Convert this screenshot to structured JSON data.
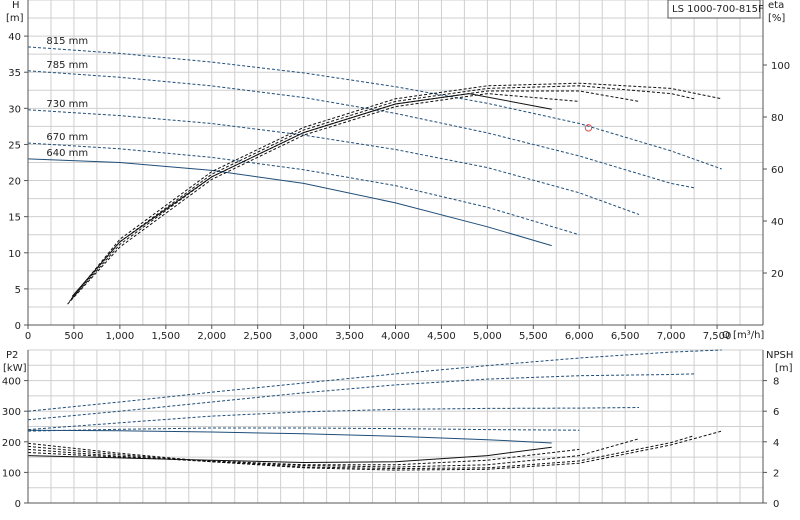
{
  "title_box": "LS 1000-700-815F",
  "top_axes": {
    "y_label_top": "H",
    "y_label_unit": "[m]",
    "y_right_label_top": "eta",
    "y_right_label_unit": "[%]",
    "x_label": "Q [m³/h]",
    "x_ticks": [
      "0",
      "500",
      "1,000",
      "1,500",
      "2,000",
      "2,500",
      "3,000",
      "3,500",
      "4,000",
      "4,500",
      "5,000",
      "5,500",
      "6,000",
      "6,500",
      "7,000",
      "7,500"
    ],
    "y_ticks": [
      "0",
      "5",
      "10",
      "15",
      "20",
      "25",
      "30",
      "35",
      "40"
    ],
    "y_right_ticks": [
      "20",
      "40",
      "60",
      "80",
      "100"
    ]
  },
  "bottom_axes": {
    "y_label_top": "P2",
    "y_label_unit": "[kW]",
    "y_right_label_top": "NPSH",
    "y_right_label_unit": "[m]",
    "y_ticks": [
      "0",
      "100",
      "200",
      "300",
      "400"
    ],
    "y_right_ticks": [
      "0",
      "2",
      "4",
      "6",
      "8"
    ]
  },
  "colors": {
    "blue": "#1f4e79",
    "black": "#111111",
    "marker": "#e05050"
  },
  "chart_data": [
    {
      "type": "line",
      "xlim": [
        0,
        8000
      ],
      "ylim": [
        0,
        45
      ],
      "y2lim": [
        0,
        125
      ],
      "series": [
        {
          "name": "815 mm",
          "style": "dashed",
          "x": [
            0,
            1000,
            2000,
            3000,
            4000,
            5000,
            6000,
            7000,
            7550
          ],
          "y": [
            38.5,
            37.6,
            36.4,
            34.9,
            33.0,
            30.7,
            27.9,
            24.1,
            21.6
          ]
        },
        {
          "name": "785 mm",
          "style": "dashed",
          "x": [
            0,
            1000,
            2000,
            3000,
            4000,
            5000,
            6000,
            7000,
            7250
          ],
          "y": [
            35.2,
            34.3,
            33.1,
            31.5,
            29.3,
            26.6,
            23.4,
            19.6,
            19.0
          ]
        },
        {
          "name": "730 mm",
          "style": "dashed",
          "x": [
            0,
            1000,
            2000,
            3000,
            4000,
            5000,
            6000,
            6650
          ],
          "y": [
            29.8,
            29.0,
            27.9,
            26.3,
            24.3,
            21.8,
            18.3,
            15.3
          ]
        },
        {
          "name": "670 mm",
          "style": "dashed",
          "x": [
            0,
            1000,
            2000,
            3000,
            4000,
            5000,
            6000
          ],
          "y": [
            25.2,
            24.4,
            23.2,
            21.5,
            19.3,
            16.3,
            12.5
          ]
        },
        {
          "name": "640 mm",
          "style": "solid",
          "x": [
            0,
            1000,
            2000,
            3000,
            4000,
            5000,
            5700
          ],
          "y": [
            23.0,
            22.5,
            21.4,
            19.6,
            16.9,
            13.6,
            11.0
          ]
        }
      ],
      "eta_series": [
        {
          "style": "solid",
          "x": [
            480,
            1000,
            2000,
            3000,
            4000,
            4800,
            5700
          ],
          "y": [
            11,
            32,
            57,
            74,
            85,
            89,
            83
          ]
        },
        {
          "style": "dashed",
          "x": [
            430,
            1000,
            2000,
            3000,
            4000,
            5000,
            6000
          ],
          "y": [
            8,
            30,
            56,
            73,
            84,
            89,
            86
          ]
        },
        {
          "style": "dashed",
          "x": [
            450,
            1000,
            2000,
            3000,
            4000,
            5000,
            6000,
            6650
          ],
          "y": [
            9,
            31,
            57,
            74,
            85,
            90,
            90,
            86
          ]
        },
        {
          "style": "dashed",
          "x": [
            470,
            1000,
            2000,
            3000,
            4000,
            5000,
            6000,
            7000,
            7250
          ],
          "y": [
            10,
            32,
            58,
            75,
            86,
            91,
            92,
            89,
            87
          ]
        },
        {
          "style": "dashed",
          "x": [
            490,
            1000,
            2000,
            3000,
            4000,
            5000,
            6000,
            7000,
            7550
          ],
          "y": [
            11,
            33,
            59,
            76,
            87,
            92,
            93,
            91,
            87
          ]
        }
      ],
      "duty_point": {
        "x": 6100,
        "y": 27.3
      }
    },
    {
      "type": "line",
      "xlim": [
        0,
        8000
      ],
      "ylim": [
        0,
        500
      ],
      "y2lim": [
        0,
        10
      ],
      "p2_series": [
        {
          "style": "dashed",
          "x": [
            0,
            1000,
            2000,
            3000,
            4000,
            5000,
            6000,
            7000,
            7550
          ],
          "y": [
            300,
            330,
            362,
            392,
            422,
            449,
            474,
            493,
            500
          ]
        },
        {
          "style": "dashed",
          "x": [
            0,
            1000,
            2000,
            3000,
            4000,
            5000,
            6000,
            7000,
            7250
          ],
          "y": [
            272,
            300,
            330,
            360,
            386,
            405,
            416,
            420,
            422
          ]
        },
        {
          "style": "dashed",
          "x": [
            0,
            1000,
            2000,
            3000,
            4000,
            5000,
            6000,
            6650
          ],
          "y": [
            240,
            262,
            284,
            298,
            306,
            309,
            310,
            312
          ]
        },
        {
          "style": "dashed",
          "x": [
            0,
            1000,
            2000,
            3000,
            4000,
            5000,
            6000
          ],
          "y": [
            235,
            241,
            245,
            245,
            243,
            240,
            238
          ]
        },
        {
          "style": "solid",
          "x": [
            0,
            1000,
            2000,
            3000,
            4000,
            5000,
            5700
          ],
          "y": [
            238,
            236,
            232,
            226,
            218,
            207,
            196
          ]
        }
      ],
      "npsh_series": [
        {
          "style": "solid",
          "x": [
            0,
            1000,
            2000,
            3000,
            4000,
            5000,
            5700
          ],
          "y": [
            3.1,
            2.95,
            2.8,
            2.65,
            2.7,
            3.1,
            3.65
          ]
        },
        {
          "style": "dashed",
          "x": [
            0,
            1000,
            2000,
            3000,
            4000,
            5000,
            6000
          ],
          "y": [
            3.3,
            3.0,
            2.75,
            2.5,
            2.5,
            2.8,
            3.5
          ]
        },
        {
          "style": "dashed",
          "x": [
            0,
            1000,
            2000,
            3000,
            4000,
            5000,
            6000,
            6650
          ],
          "y": [
            3.5,
            3.05,
            2.7,
            2.45,
            2.35,
            2.5,
            3.1,
            4.2
          ]
        },
        {
          "style": "dashed",
          "x": [
            0,
            1000,
            2000,
            3000,
            4000,
            5000,
            6000,
            7000,
            7250
          ],
          "y": [
            3.7,
            3.15,
            2.7,
            2.35,
            2.25,
            2.3,
            2.75,
            3.95,
            4.4
          ]
        },
        {
          "style": "dashed",
          "x": [
            0,
            1000,
            2000,
            3000,
            4000,
            5000,
            6000,
            7000,
            7550
          ],
          "y": [
            3.9,
            3.25,
            2.7,
            2.3,
            2.15,
            2.2,
            2.6,
            3.8,
            4.7
          ]
        }
      ]
    }
  ]
}
